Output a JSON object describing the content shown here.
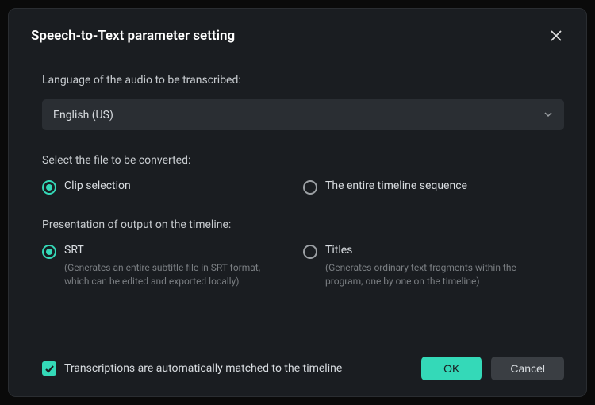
{
  "dialog": {
    "title": "Speech-to-Text parameter setting"
  },
  "language": {
    "label": "Language of the audio to be transcribed:",
    "selected": "English (US)"
  },
  "fileSelection": {
    "label": "Select the file to be converted:",
    "options": {
      "clip": "Clip selection",
      "timeline": "The entire timeline sequence"
    }
  },
  "presentation": {
    "label": "Presentation of output on the timeline:",
    "options": {
      "srt": {
        "label": "SRT",
        "desc": "(Generates an entire subtitle file in SRT format, which can be edited and exported locally)"
      },
      "titles": {
        "label": "Titles",
        "desc": "(Generates ordinary text fragments within the program, one by one on the timeline)"
      }
    }
  },
  "autoMatch": {
    "label": "Transcriptions are automatically matched to the timeline"
  },
  "buttons": {
    "ok": "OK",
    "cancel": "Cancel"
  },
  "colors": {
    "accent": "#34d9b8",
    "background": "#1a1d21"
  }
}
